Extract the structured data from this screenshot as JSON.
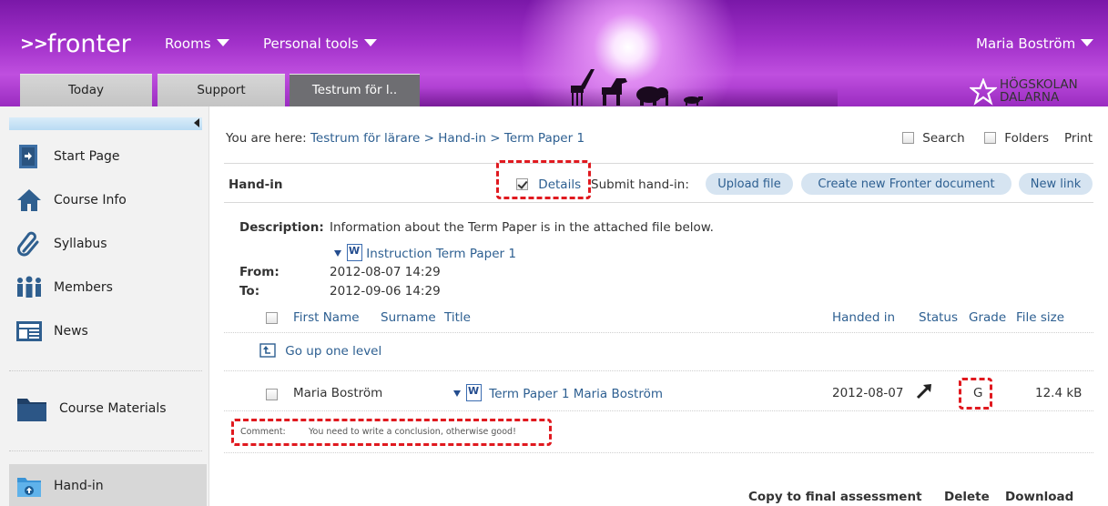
{
  "header": {
    "logo_arrows": ">>",
    "logo_word": "fronter",
    "menu_rooms": "Rooms",
    "menu_personal_tools": "Personal tools",
    "user_name": "Maria Boström",
    "tabs": [
      {
        "label": "Today"
      },
      {
        "label": "Support"
      },
      {
        "label": "Testrum för l.."
      }
    ],
    "school_line1": "HÖGSKOLAN",
    "school_line2": "DALARNA"
  },
  "sidebar": {
    "items": [
      {
        "label": "Start Page",
        "icon": "door-icon"
      },
      {
        "label": "Course Info",
        "icon": "house-icon"
      },
      {
        "label": "Syllabus",
        "icon": "paperclip-icon"
      },
      {
        "label": "Members",
        "icon": "people-icon"
      },
      {
        "label": "News",
        "icon": "newspaper-icon"
      },
      {
        "label": "Course Materials",
        "icon": "folder-icon"
      },
      {
        "label": "Hand-in",
        "icon": "handin-folder-icon"
      }
    ]
  },
  "main": {
    "breadcrumb_prefix": "You are here:",
    "breadcrumb_1": "Testrum för lärare",
    "breadcrumb_sep_1": ">",
    "breadcrumb_2": "Hand-in",
    "breadcrumb_sep_2": ">",
    "breadcrumb_3": "Term Paper 1",
    "search_label": "Search",
    "folders_label": "Folders",
    "print_label": "Print",
    "section_title": "Hand-in",
    "details_label": "Details",
    "details_checked": true,
    "submit_label": "Submit hand-in:",
    "upload_button": "Upload file",
    "create_button": "Create new Fronter document",
    "newlink_button": "New link",
    "description_label": "Description:",
    "description_text": "Information about the Term Paper is in the attached file below.",
    "attachment_name": "Instruction Term Paper 1",
    "from_label": "From:",
    "from_value": "2012-08-07 14:29",
    "to_label": "To:",
    "to_value": "2012-09-06 14:29",
    "table_headers": {
      "first_name": "First Name",
      "surname": "Surname",
      "title": "Title",
      "handed_in": "Handed in",
      "status": "Status",
      "grade": "Grade",
      "file_size": "File size"
    },
    "go_up": "Go up one level",
    "row": {
      "name": "Maria Boström",
      "title": "Term Paper 1 Maria Boström",
      "handed_in": "2012-08-07",
      "grade": "G",
      "file_size": "12.4 kB"
    },
    "comment_label": "Comment:",
    "comment_text": "You need to write a conclusion, otherwise good!",
    "actions": {
      "copy": "Copy to final assessment",
      "delete": "Delete",
      "download": "Download"
    }
  },
  "colors": {
    "banner_purple": "#a130c9",
    "link_blue": "#2d5f91",
    "pill_blue": "#d6e4f1",
    "highlight_red": "#e0191f"
  }
}
